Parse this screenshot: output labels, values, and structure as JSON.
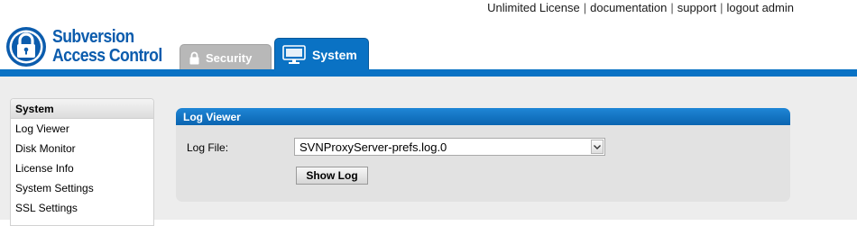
{
  "header": {
    "links": [
      "Unlimited License",
      "documentation",
      "support",
      "logout admin"
    ],
    "separator": "|"
  },
  "logo": {
    "line1": "Subversion",
    "line2": "Access Control",
    "icon": "padlock-icon"
  },
  "tabs": [
    {
      "label": "Security",
      "icon": "lock-icon",
      "active": false
    },
    {
      "label": "System",
      "icon": "monitor-icon",
      "active": true
    }
  ],
  "colors": {
    "accent": "#0a72c4",
    "tab_inactive": "#b8b8b8",
    "content_bg": "#ededed",
    "panel_bg": "#e2e2e2"
  },
  "sidebar": {
    "title": "System",
    "items": [
      "Log Viewer",
      "Disk Monitor",
      "License Info",
      "System Settings",
      "SSL Settings"
    ]
  },
  "panel": {
    "title": "Log Viewer",
    "log_file_label": "Log File:",
    "log_file_value": "SVNProxyServer-prefs.log.0",
    "show_log_label": "Show Log"
  }
}
